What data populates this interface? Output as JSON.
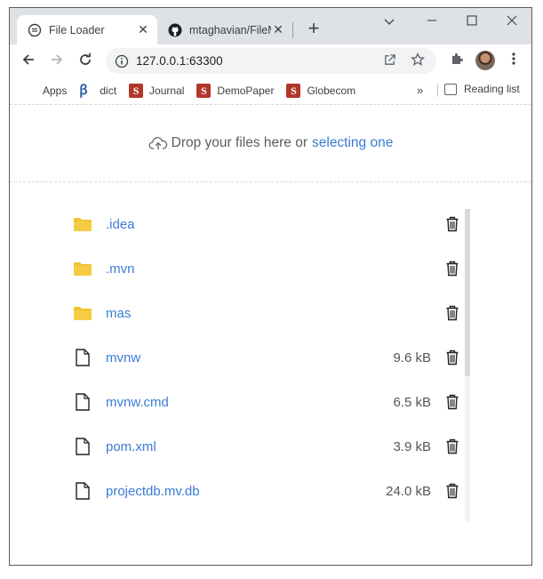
{
  "browser": {
    "tabs": [
      {
        "title": "File Loader",
        "active": true,
        "icon": "chat-bubble-icon"
      },
      {
        "title": "mtaghavian/FileM",
        "active": false,
        "icon": "github-icon"
      }
    ],
    "new_tab_label": "+",
    "url": "127.0.0.1:63300",
    "bookmarks": [
      {
        "label": "Apps",
        "icon": "apps-grid-icon"
      },
      {
        "label": "dict",
        "icon": "dict-icon"
      },
      {
        "label": "Journal",
        "icon": "s-icon"
      },
      {
        "label": "DemoPaper",
        "icon": "s-icon"
      },
      {
        "label": "Globecom",
        "icon": "s-icon"
      }
    ],
    "more_bookmarks": "»",
    "reading_list": "Reading list"
  },
  "dropzone": {
    "text": "Drop your files here or",
    "link": "selecting one"
  },
  "files": [
    {
      "name": ".idea",
      "type": "folder",
      "size": ""
    },
    {
      "name": ".mvn",
      "type": "folder",
      "size": ""
    },
    {
      "name": "mas",
      "type": "folder",
      "size": ""
    },
    {
      "name": "mvnw",
      "type": "file",
      "size": "9.6 kB"
    },
    {
      "name": "mvnw.cmd",
      "type": "file",
      "size": "6.5 kB"
    },
    {
      "name": "pom.xml",
      "type": "file",
      "size": "3.9 kB"
    },
    {
      "name": "projectdb.mv.db",
      "type": "file",
      "size": "24.0 kB"
    }
  ],
  "colors": {
    "link": "#3a7bd5",
    "folder": "#f2c12e",
    "tabstrip": "#dee1e6"
  }
}
